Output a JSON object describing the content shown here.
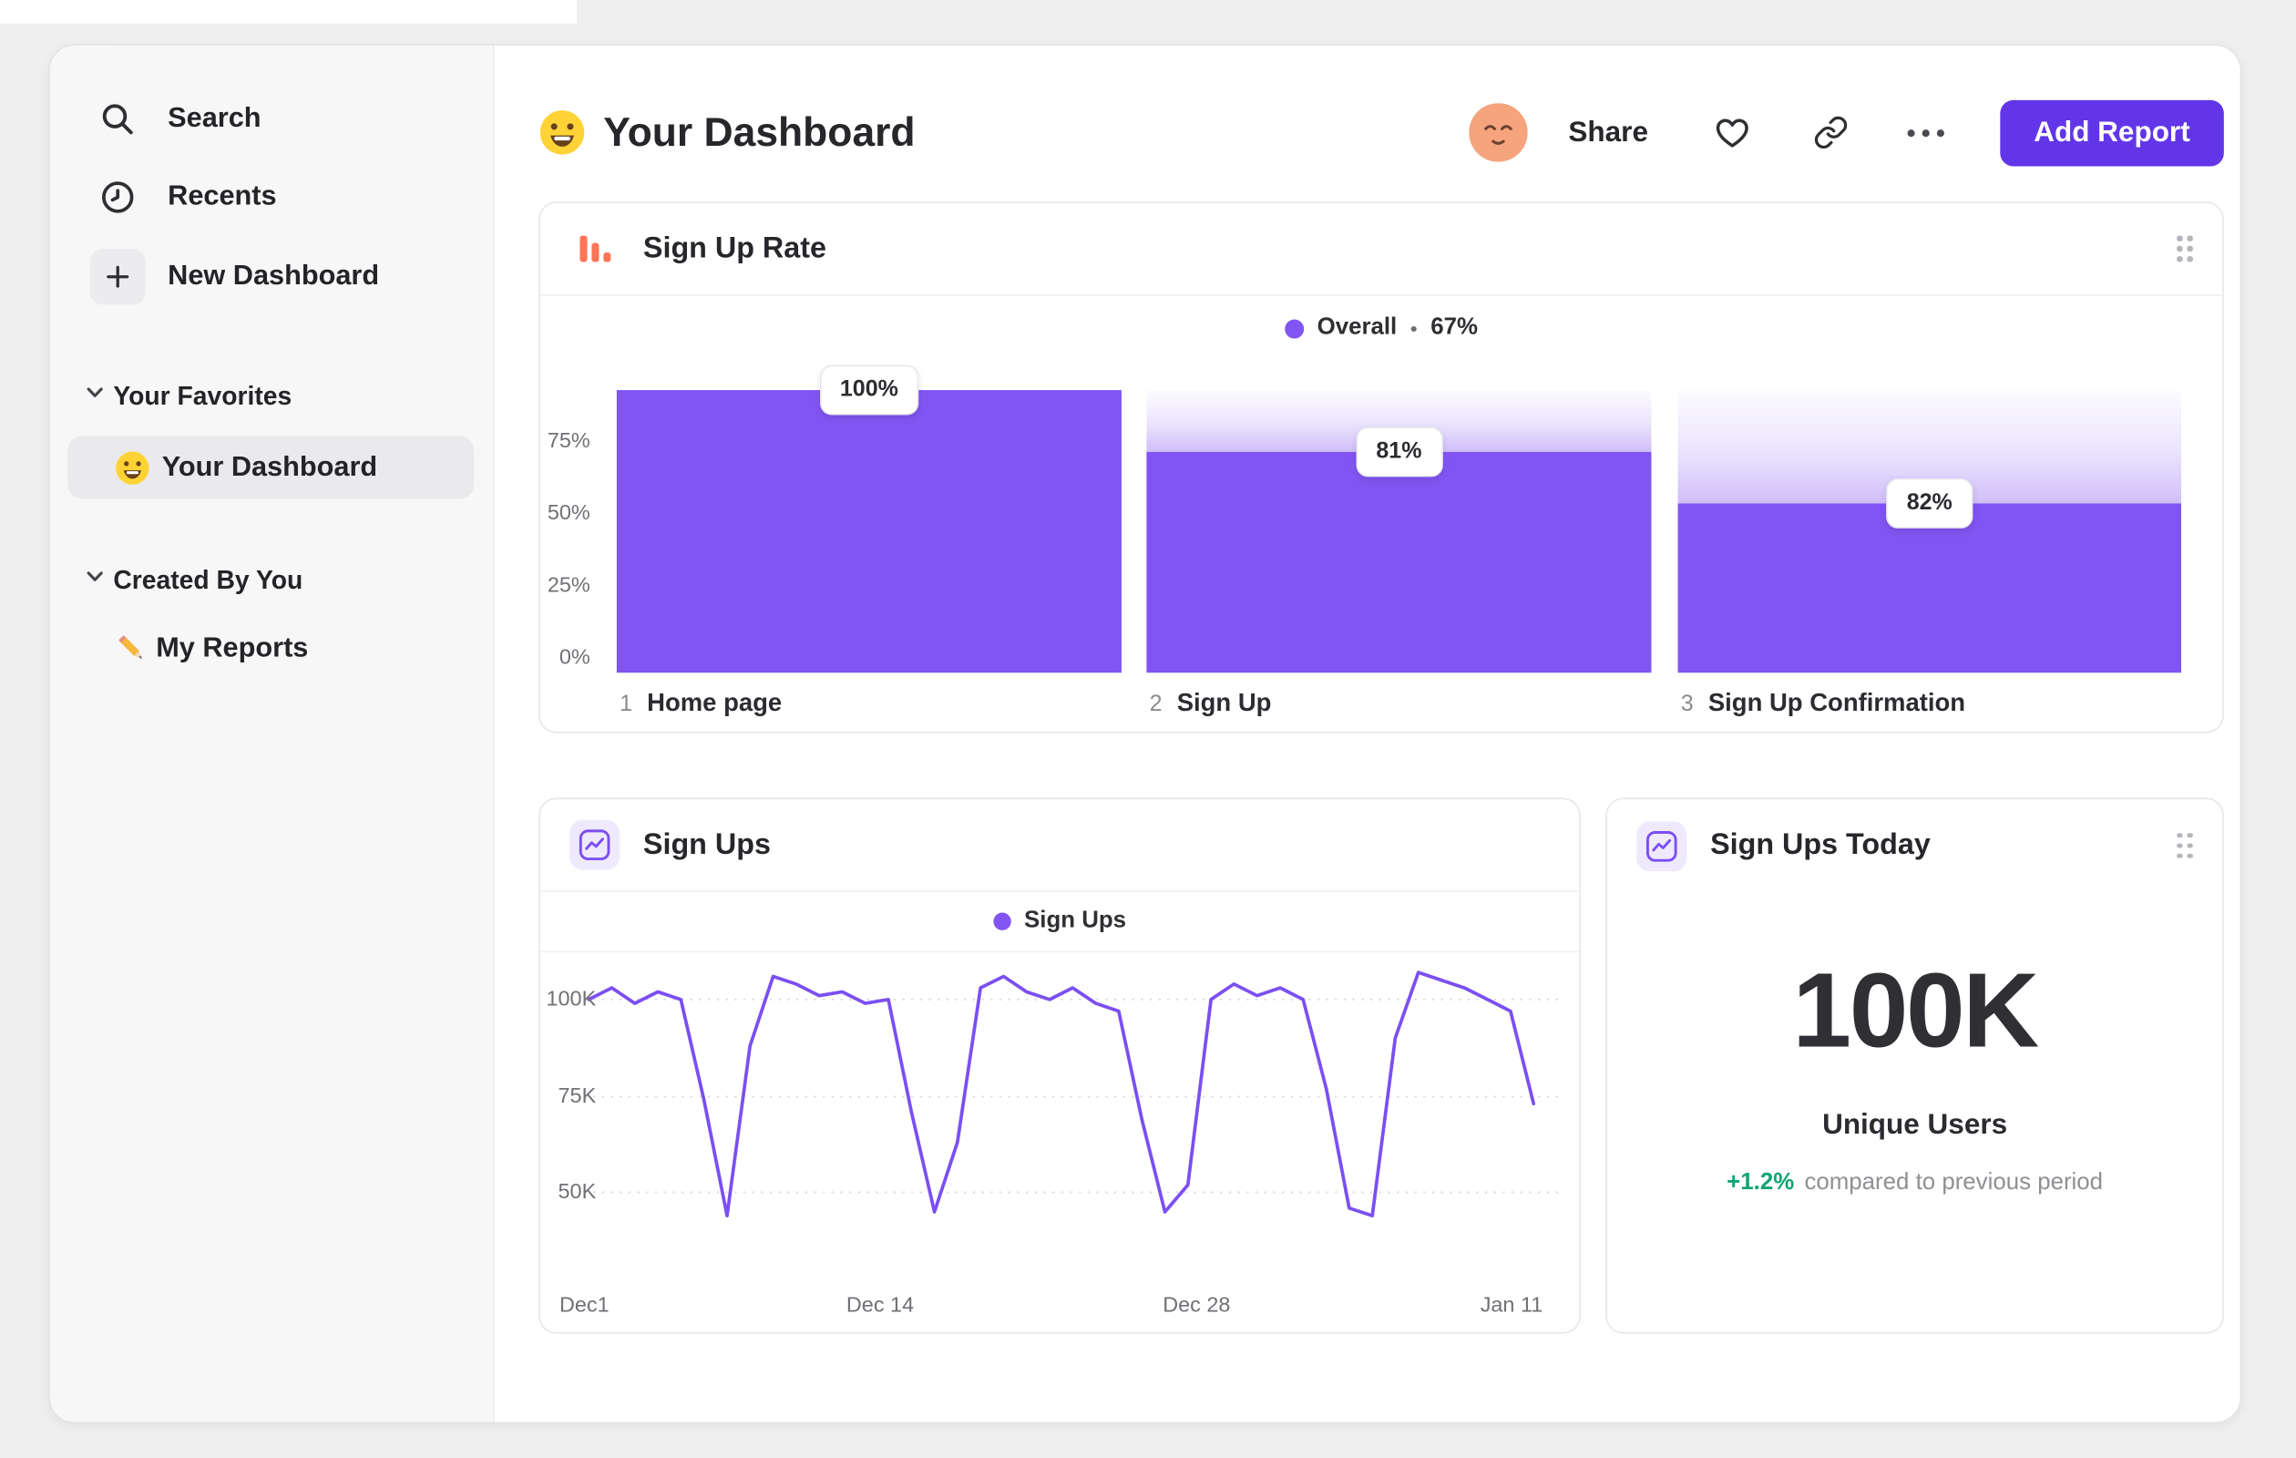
{
  "colors": {
    "accent_purple": "#8155F2",
    "button_purple": "#6236E8",
    "orange": "#FF7557",
    "green": "#0FA573",
    "selected_gray": "#EAEAEC"
  },
  "icons": {
    "search": "magnifier",
    "recents": "clock",
    "new_dashboard": "plus",
    "sections": "chevron-down",
    "favorite_item": "smiley-emoji",
    "reports_item": "pencil-emoji",
    "funnel_card": "orange-bars",
    "line_card": "purple-line-chart",
    "kpi_card": "purple-line-chart",
    "share_heart": "heart-outline",
    "share_link": "chain-link",
    "more": "ellipsis",
    "drag": "six-dot-handle",
    "avatar": "relieved-face"
  },
  "sidebar": {
    "search": "Search",
    "recents": "Recents",
    "new_dashboard": "New Dashboard",
    "favorites_header": "Your Favorites",
    "favorite_item": "Your Dashboard",
    "created_header": "Created By You",
    "reports_item": "My Reports"
  },
  "header": {
    "title": "Your Dashboard",
    "share": "Share",
    "add_report": "Add Report"
  },
  "chart_data": [
    {
      "type": "bar",
      "subtype": "funnel",
      "title": "Sign Up Rate",
      "legend": {
        "label": "Overall",
        "sep": "•",
        "value": "67%"
      },
      "y_ticks": [
        "75%",
        "50%",
        "25%",
        "0%"
      ],
      "ylim": [
        0,
        100
      ],
      "categories": [
        "Home page",
        "Sign Up",
        "Sign Up Confirmation"
      ],
      "values": [
        100,
        81,
        82
      ],
      "overall_heights_pct": [
        100,
        78,
        60
      ],
      "steps": [
        {
          "num": "1",
          "label": "Home page",
          "value": "100%"
        },
        {
          "num": "2",
          "label": "Sign Up",
          "value": "81%"
        },
        {
          "num": "3",
          "label": "Sign Up Confirmation",
          "value": "82%"
        }
      ]
    },
    {
      "type": "line",
      "title": "Sign Ups",
      "legend": "Sign Ups",
      "y_ticks": [
        "100K",
        "75K",
        "50K"
      ],
      "x_ticks": [
        "Dec1",
        "Dec 14",
        "Dec 28",
        "Jan 11"
      ],
      "ylim_k": [
        40,
        112
      ],
      "values_k": [
        100,
        103,
        99,
        102,
        100,
        74,
        44,
        88,
        106,
        104,
        101,
        102,
        99,
        100,
        71,
        45,
        63,
        103,
        106,
        102,
        100,
        103,
        99,
        97,
        69,
        45,
        52,
        100,
        104,
        101,
        103,
        100,
        77,
        46,
        44,
        90,
        107,
        105,
        103,
        100,
        97,
        73
      ]
    },
    {
      "type": "kpi",
      "title": "Sign Ups Today",
      "value": "100K",
      "label": "Unique Users",
      "delta": "+1.2%",
      "delta_caption": "compared to previous period"
    }
  ]
}
